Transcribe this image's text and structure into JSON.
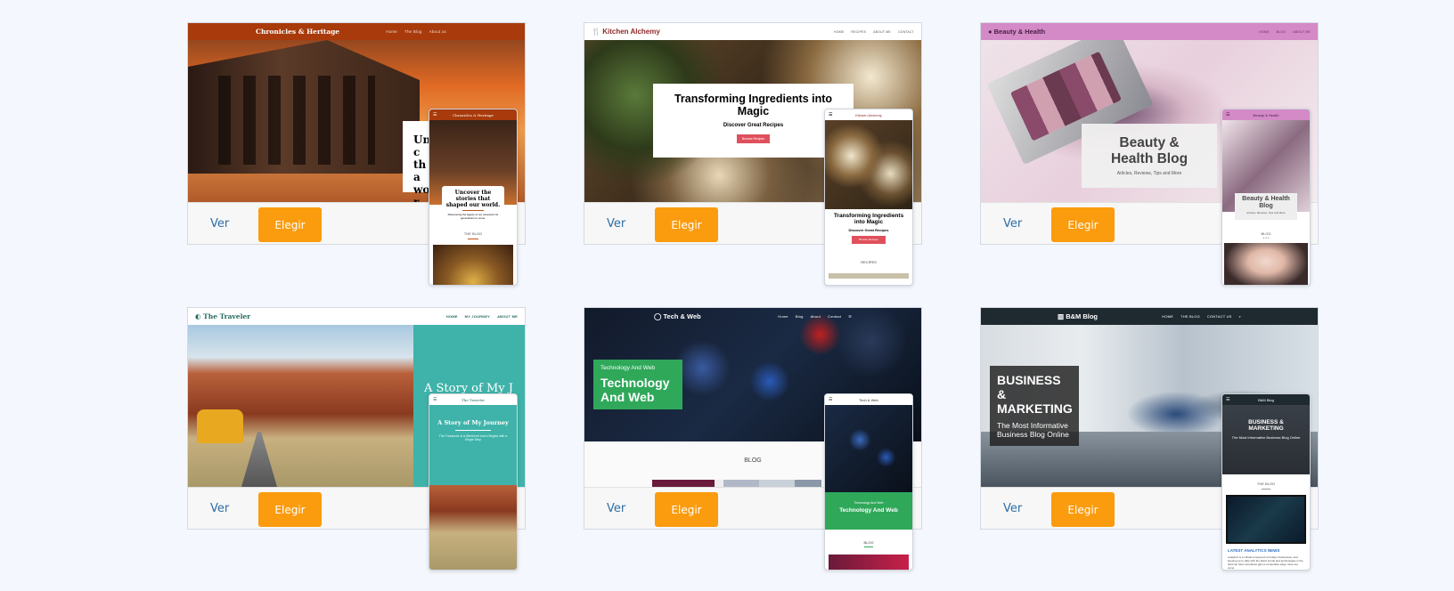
{
  "actions": {
    "view": "Ver",
    "choose": "Elegir"
  },
  "cards": [
    {
      "brand": "Chronicles & Heritage",
      "nav": [
        "Home",
        "The Blog",
        "About us"
      ],
      "hero_partial": "Unc tha wor",
      "mobile_heading": "Uncover the stories that shaped our world.",
      "mobile_sub": "Discovering the legacy of our ancestors for generations to come.",
      "mobile_section": "THE BLOG",
      "colors": {
        "bar": "#a83a0b",
        "accent": "#c0541b"
      }
    },
    {
      "brand": "Kitchen Alchemy",
      "nav": [
        "HOME",
        "RECIPES",
        "ABOUT ME",
        "CONTACT"
      ],
      "hero_title": "Transforming Ingredients into Magic",
      "hero_sub": "Discover Great Recipes",
      "hero_btn": "Browse Recipes",
      "mobile_section": "RECIPES",
      "colors": {
        "brand": "#8e2a2a",
        "btn": "#e0505c"
      }
    },
    {
      "brand": "Beauty & Health",
      "nav": [
        "HOME",
        "BLOG",
        "ABOUT ME"
      ],
      "hero_title": "Beauty & Health Blog",
      "hero_sub": "Articles, Reviews, Tips and More",
      "mobile_section": "BLOG",
      "colors": {
        "bar": "#d38ac7"
      }
    },
    {
      "brand": "The Traveler",
      "nav": [
        "HOME",
        "MY JOURNEY",
        "ABOUT ME"
      ],
      "hero_title": "A Story of My J",
      "mobile_heading": "A Story of My Journey",
      "mobile_sub": "The Treasures of a Weekend and a Begins with a Single Step",
      "colors": {
        "teal": "#3fb3a9"
      }
    },
    {
      "brand": "Tech & Web",
      "nav": [
        "Home",
        "Blog",
        "About",
        "Contact"
      ],
      "hero_kicker": "Technology And Web",
      "hero_title": "Technology And Web",
      "section": "BLOG",
      "mobile_kicker": "Technology And Web",
      "mobile_title": "Technology And Web",
      "mobile_section": "BLOG",
      "colors": {
        "green": "#2fa85a"
      }
    },
    {
      "brand": "B&M Blog",
      "nav": [
        "HOME",
        "THE BLOG",
        "CONTACT US"
      ],
      "hero_title": "BUSINESS & MARKETING",
      "hero_sub": "The Most Informative Business Blog Online",
      "mobile_section": "THE BLOG",
      "mobile_post_title": "LATEST ANALYTICS NEWS",
      "mobile_post_text": "Analytics is a critical component of today's businesses, and keeping up to date with the latest trends and technologies in the field can help companies gain a competitive edge. Here are some",
      "colors": {
        "bar": "#1e2a30",
        "link": "#2a6fc0"
      }
    }
  ]
}
